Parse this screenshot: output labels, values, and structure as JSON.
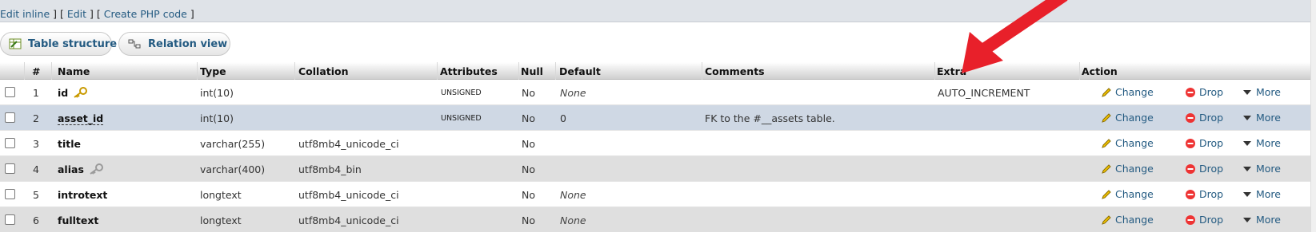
{
  "top_links": {
    "edit_inline": "Edit inline",
    "edit": "Edit",
    "create_php": "Create PHP code"
  },
  "tabs": [
    {
      "label": "Table structure",
      "icon": "table-structure-icon"
    },
    {
      "label": "Relation view",
      "icon": "relation-view-icon"
    }
  ],
  "columns": [
    "#",
    "Name",
    "Type",
    "Collation",
    "Attributes",
    "Null",
    "Default",
    "Comments",
    "Extra",
    "Action"
  ],
  "actions": {
    "change": "Change",
    "drop": "Drop",
    "more": "More"
  },
  "rows": [
    {
      "num": "1",
      "name": "id",
      "type": "int(10)",
      "collation": "",
      "attributes": "UNSIGNED",
      "null": "No",
      "default": "None",
      "comments": "",
      "extra": "AUTO_INCREMENT",
      "key": "primary"
    },
    {
      "num": "2",
      "name": "asset_id",
      "type": "int(10)",
      "collation": "",
      "attributes": "UNSIGNED",
      "null": "No",
      "default": "0",
      "comments": "FK to the #__assets table.",
      "extra": "",
      "key": ""
    },
    {
      "num": "3",
      "name": "title",
      "type": "varchar(255)",
      "collation": "utf8mb4_unicode_ci",
      "attributes": "",
      "null": "No",
      "default": "",
      "comments": "",
      "extra": "",
      "key": ""
    },
    {
      "num": "4",
      "name": "alias",
      "type": "varchar(400)",
      "collation": "utf8mb4_bin",
      "attributes": "",
      "null": "No",
      "default": "",
      "comments": "",
      "extra": "",
      "key": "index"
    },
    {
      "num": "5",
      "name": "introtext",
      "type": "longtext",
      "collation": "utf8mb4_unicode_ci",
      "attributes": "",
      "null": "No",
      "default": "None",
      "comments": "",
      "extra": "",
      "key": ""
    },
    {
      "num": "6",
      "name": "fulltext",
      "type": "longtext",
      "collation": "utf8mb4_unicode_ci",
      "attributes": "",
      "null": "No",
      "default": "None",
      "comments": "",
      "extra": "",
      "key": ""
    }
  ],
  "colors": {
    "link": "#235a81",
    "arrow": "#e8202a",
    "selected_row": "#cfd8e4",
    "even_row": "#dfdfdf"
  }
}
